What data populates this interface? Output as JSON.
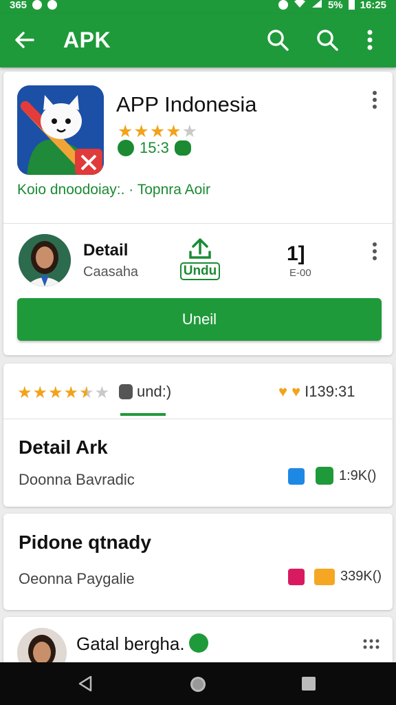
{
  "status_bar": {
    "left_text": "365",
    "battery": "5%",
    "time": "16:25"
  },
  "app_bar": {
    "title": "APK",
    "icons": [
      "back-arrow-icon",
      "search-icon",
      "search-icon",
      "more-vert-icon"
    ]
  },
  "app_card": {
    "name": "APP Indonesia",
    "rating_stars": 4,
    "meta_value": "15:3",
    "tagline": "Koio dnoodoiay:. · Topnra Aoir"
  },
  "detail_card": {
    "title": "Detail",
    "subtitle": "Caasaha",
    "download_label": "Undu",
    "count_value": "1]",
    "count_sub": "E-00",
    "install_label": "Uneil"
  },
  "tabs_row": {
    "rating_stars": 4.5,
    "tab_label": "und:)",
    "score": "I139:31"
  },
  "list": [
    {
      "title": "Detail Ark",
      "subtitle": "Doonna Bavradic",
      "size": "1:9K()"
    },
    {
      "title": "Pidone qtnady",
      "subtitle": "Oeonna Paygalie",
      "size": "339K()"
    }
  ],
  "bottom_item": {
    "title": "Gatal bergha."
  },
  "colors": {
    "primary": "#1f9a3a",
    "star": "#f2a31c",
    "nav": "#0b0b0b"
  }
}
